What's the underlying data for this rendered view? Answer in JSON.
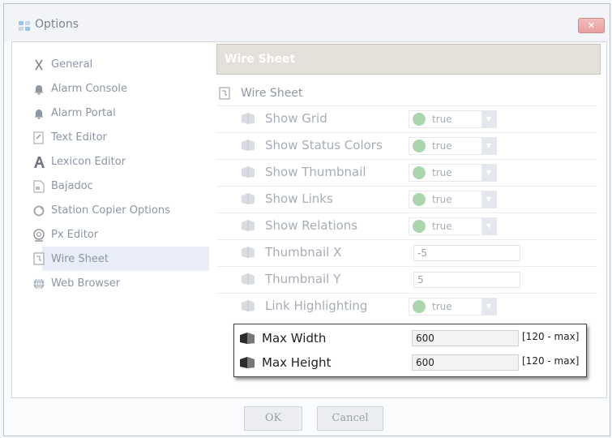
{
  "window": {
    "title": "Options",
    "close_symbol": "✕"
  },
  "sidebar": {
    "items": [
      {
        "label": "General",
        "icon": "x-tool-icon",
        "selected": false
      },
      {
        "label": "Alarm Console",
        "icon": "bell-icon",
        "selected": false
      },
      {
        "label": "Alarm Portal",
        "icon": "bell-icon",
        "selected": false
      },
      {
        "label": "Text Editor",
        "icon": "text-editor-icon",
        "selected": false
      },
      {
        "label": "Lexicon Editor",
        "icon": "lexicon-a-icon",
        "selected": false
      },
      {
        "label": "Bajadoc",
        "icon": "document-icon",
        "selected": false
      },
      {
        "label": "Station Copier Options",
        "icon": "refresh-icon",
        "selected": false
      },
      {
        "label": "Px Editor",
        "icon": "px-editor-icon",
        "selected": false
      },
      {
        "label": "Wire Sheet",
        "icon": "wire-sheet-icon",
        "selected": true
      },
      {
        "label": "Web Browser",
        "icon": "globe-icon",
        "selected": false
      }
    ]
  },
  "panel": {
    "header": "Wire Sheet",
    "section_label": "Wire Sheet",
    "properties": [
      {
        "label": "Show Grid",
        "kind": "bool",
        "value": "true"
      },
      {
        "label": "Show Status Colors",
        "kind": "bool",
        "value": "true"
      },
      {
        "label": "Show Thumbnail",
        "kind": "bool",
        "value": "true"
      },
      {
        "label": "Show Links",
        "kind": "bool",
        "value": "true"
      },
      {
        "label": "Show Relations",
        "kind": "bool",
        "value": "true"
      },
      {
        "label": "Thumbnail X",
        "kind": "text",
        "value": "-5"
      },
      {
        "label": "Thumbnail Y",
        "kind": "text",
        "value": "5"
      },
      {
        "label": "Link Highlighting",
        "kind": "bool",
        "value": "true"
      }
    ],
    "highlighted": [
      {
        "label": "Max Width",
        "value": "600",
        "range": "[120 - max]"
      },
      {
        "label": "Max Height",
        "value": "600",
        "range": "[120 - max]"
      }
    ]
  },
  "buttons": {
    "ok": "OK",
    "cancel": "Cancel"
  },
  "colors": {
    "bool_dot": "#abd6ad",
    "selected_bg": "#e8edf7",
    "header_bg": "#e4e0da"
  }
}
